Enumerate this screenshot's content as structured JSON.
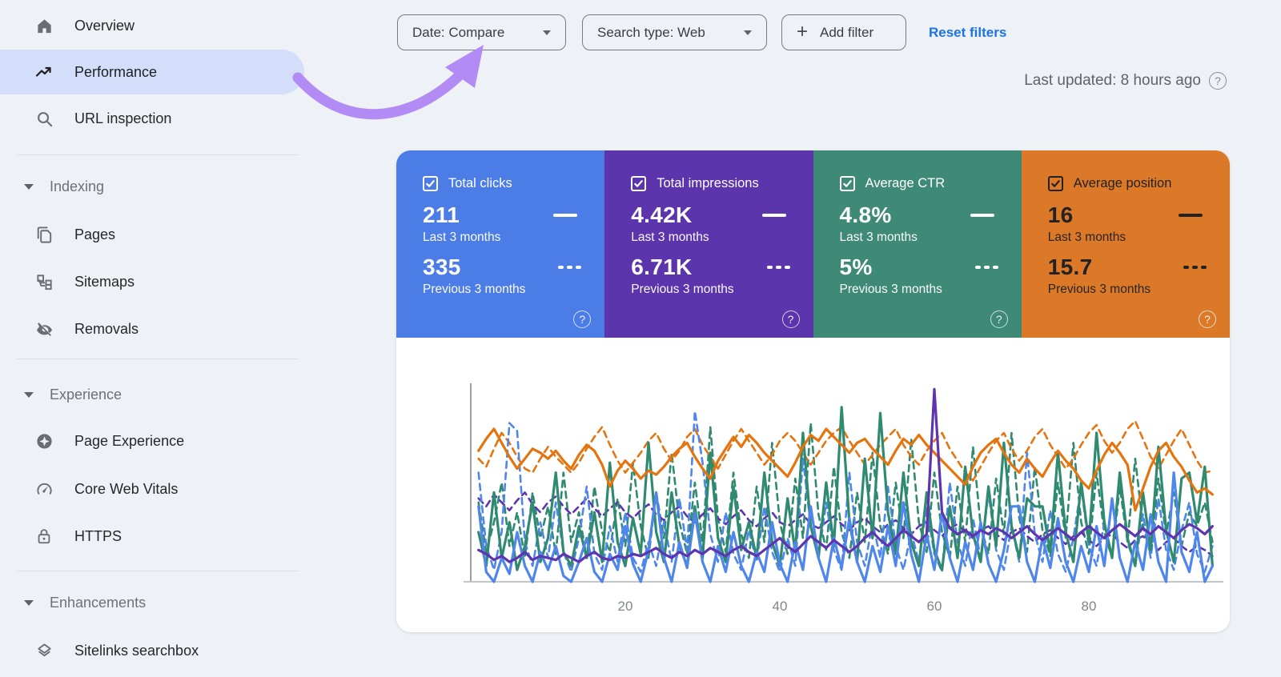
{
  "sidebar": {
    "items": [
      {
        "label": "Overview",
        "icon": "home-icon"
      },
      {
        "label": "Performance",
        "icon": "performance-icon",
        "active": true
      },
      {
        "label": "URL inspection",
        "icon": "search-icon"
      }
    ],
    "sections": [
      {
        "header": "Indexing",
        "items": [
          {
            "label": "Pages",
            "icon": "pages-icon"
          },
          {
            "label": "Sitemaps",
            "icon": "sitemaps-icon"
          },
          {
            "label": "Removals",
            "icon": "eye-off-icon"
          }
        ]
      },
      {
        "header": "Experience",
        "items": [
          {
            "label": "Page Experience",
            "icon": "page-experience-icon"
          },
          {
            "label": "Core Web Vitals",
            "icon": "speedometer-icon"
          },
          {
            "label": "HTTPS",
            "icon": "lock-icon"
          }
        ]
      },
      {
        "header": "Enhancements",
        "items": [
          {
            "label": "Sitelinks searchbox",
            "icon": "layers-icon"
          }
        ]
      }
    ],
    "active_pill_color": "#d3defb"
  },
  "toolbar": {
    "date_filter": "Date: Compare",
    "search_type_filter": "Search type: Web",
    "add_filter_label": "Add filter",
    "reset_filters_label": "Reset filters",
    "last_updated": "Last updated: 8 hours ago",
    "link_color": "#1a73e8"
  },
  "cards": [
    {
      "label": "Total clicks",
      "bg": "#4c7de6",
      "text": "#ffffff",
      "current": "211",
      "current_caption": "Last 3 months",
      "previous": "335",
      "previous_caption": "Previous 3 months",
      "checked": true
    },
    {
      "label": "Total impressions",
      "bg": "#5c34ac",
      "text": "#ffffff",
      "current": "4.42K",
      "current_caption": "Last 3 months",
      "previous": "6.71K",
      "previous_caption": "Previous 3 months",
      "checked": true
    },
    {
      "label": "Average CTR",
      "bg": "#3f8977",
      "text": "#ffffff",
      "current": "4.8%",
      "current_caption": "Last 3 months",
      "previous": "5%",
      "previous_caption": "Previous 3 months",
      "checked": true
    },
    {
      "label": "Average position",
      "bg": "#dc7928",
      "text": "#222222",
      "current": "16",
      "current_caption": "Last 3 months",
      "previous": "15.7",
      "previous_caption": "Previous 3 months",
      "checked": true
    }
  ],
  "chart_data": {
    "type": "line",
    "title": "",
    "xlabel": "",
    "ylabel": "",
    "x_ticks": [
      20,
      40,
      60,
      80
    ],
    "x_unit": "days",
    "x_range": [
      1,
      96
    ],
    "y_axis_unlabeled": true,
    "values_unit": "percent of plot height (0 = baseline, 100 = top; each metric has its own hidden scale)",
    "grid": false,
    "legend": "none (series colors match the metric cards; solid = Last 3 months, dashed = Previous 3 months)",
    "series": [
      {
        "name": "Average CTR — Previous 3 months",
        "metric": "ctr",
        "period": "previous",
        "color": "#2f8a70",
        "style": "dashed",
        "values": [
          40,
          15,
          30,
          50,
          18,
          35,
          12,
          45,
          22,
          38,
          14,
          55,
          20,
          35,
          12,
          48,
          25,
          15,
          42,
          18,
          60,
          28,
          12,
          45,
          22,
          65,
          30,
          14,
          50,
          20,
          78,
          32,
          15,
          55,
          24,
          12,
          48,
          20,
          70,
          30,
          14,
          52,
          22,
          80,
          34,
          16,
          58,
          25,
          12,
          45,
          20,
          65,
          28,
          14,
          50,
          22,
          72,
          30,
          15,
          55,
          25,
          12,
          48,
          20,
          68,
          28,
          14,
          52,
          24,
          75,
          32,
          15,
          58,
          26,
          13,
          50,
          22,
          70,
          30,
          14,
          55,
          25,
          12,
          48,
          20,
          62,
          28,
          14,
          52,
          24,
          45,
          18,
          35,
          28,
          40,
          20
        ]
      },
      {
        "name": "Average position — Previous 3 months",
        "metric": "position",
        "period": "previous",
        "color": "#e5740f",
        "style": "dashed",
        "values": [
          62,
          58,
          67,
          75,
          70,
          63,
          57,
          55,
          62,
          68,
          63,
          59,
          55,
          60,
          67,
          73,
          78,
          69,
          61,
          55,
          60,
          65,
          71,
          75,
          67,
          61,
          66,
          73,
          77,
          69,
          63,
          57,
          64,
          71,
          77,
          71,
          65,
          59,
          64,
          71,
          75,
          71,
          65,
          59,
          65,
          71,
          75,
          78,
          71,
          65,
          59,
          64,
          69,
          73,
          77,
          69,
          63,
          59,
          66,
          71,
          75,
          67,
          61,
          55,
          51,
          58,
          65,
          71,
          75,
          67,
          61,
          66,
          73,
          77,
          69,
          63,
          57,
          62,
          69,
          75,
          79,
          71,
          65,
          70,
          77,
          81,
          72,
          63,
          57,
          64,
          71,
          77,
          69,
          61,
          55,
          56
        ]
      },
      {
        "name": "Total impressions — Previous 3 months",
        "metric": "impressions",
        "period": "previous",
        "color": "#5e35b1",
        "style": "dashed",
        "values": [
          42,
          38,
          44,
          40,
          36,
          41,
          45,
          39,
          35,
          40,
          43,
          38,
          34,
          38,
          42,
          37,
          33,
          37,
          40,
          35,
          32,
          36,
          39,
          34,
          31,
          35,
          38,
          33,
          30,
          34,
          37,
          32,
          29,
          33,
          36,
          31,
          28,
          32,
          35,
          30,
          28,
          31,
          34,
          29,
          27,
          30,
          33,
          29,
          26,
          30,
          32,
          28,
          25,
          29,
          31,
          27,
          24,
          28,
          30,
          26,
          23,
          27,
          29,
          25,
          22,
          26,
          28,
          24,
          21,
          25,
          27,
          23,
          20,
          24,
          26,
          22,
          19,
          23,
          25,
          21,
          18,
          22,
          24,
          20,
          17,
          21,
          23,
          19,
          16,
          20,
          22,
          18,
          15,
          18,
          16,
          13
        ]
      },
      {
        "name": "Total clicks — Previous 3 months",
        "metric": "clicks",
        "period": "previous",
        "color": "#4f86ec",
        "style": "dashed",
        "values": [
          55,
          18,
          6,
          25,
          80,
          76,
          20,
          8,
          30,
          12,
          40,
          15,
          5,
          22,
          48,
          14,
          6,
          28,
          10,
          35,
          12,
          5,
          20,
          8,
          30,
          10,
          42,
          16,
          86,
          60,
          24,
          10,
          35,
          14,
          6,
          26,
          10,
          38,
          15,
          5,
          22,
          8,
          62,
          28,
          12,
          40,
          16,
          6,
          55,
          20,
          8,
          30,
          12,
          48,
          18,
          6,
          25,
          10,
          38,
          14,
          5,
          50,
          20,
          8,
          32,
          12,
          45,
          16,
          6,
          28,
          10,
          65,
          24,
          10,
          36,
          14,
          5,
          22,
          48,
          18,
          8,
          30,
          12,
          55,
          20,
          8,
          34,
          12,
          42,
          16,
          6,
          26,
          40,
          14,
          5,
          18
        ]
      },
      {
        "name": "Average CTR — Last 3 months",
        "metric": "ctr",
        "period": "current",
        "color": "#2f8a70",
        "style": "solid",
        "values": [
          25,
          8,
          45,
          12,
          30,
          6,
          18,
          40,
          10,
          22,
          55,
          15,
          8,
          28,
          12,
          35,
          10,
          60,
          20,
          8,
          32,
          14,
          70,
          25,
          10,
          45,
          18,
          8,
          38,
          12,
          65,
          22,
          10,
          48,
          16,
          30,
          12,
          55,
          20,
          8,
          42,
          15,
          75,
          28,
          12,
          50,
          18,
          88,
          30,
          10,
          62,
          22,
          85,
          35,
          14,
          55,
          20,
          8,
          45,
          16,
          6,
          38,
          12,
          58,
          24,
          10,
          48,
          18,
          70,
          28,
          12,
          42,
          38,
          38,
          15,
          65,
          25,
          10,
          50,
          20,
          75,
          30,
          12,
          55,
          22,
          8,
          45,
          16,
          68,
          26,
          10,
          52,
          55,
          30,
          58,
          8
        ]
      },
      {
        "name": "Average position — Last 3 months",
        "metric": "position",
        "period": "current",
        "color": "#e5740f",
        "style": "solid",
        "values": [
          66,
          72,
          77,
          70,
          63,
          57,
          62,
          67,
          65,
          62,
          66,
          61,
          57,
          64,
          69,
          66,
          59,
          48,
          56,
          61,
          57,
          52,
          56,
          54,
          58,
          63,
          67,
          70,
          63,
          57,
          52,
          61,
          67,
          73,
          68,
          74,
          70,
          65,
          61,
          57,
          53,
          60,
          68,
          74,
          71,
          77,
          73,
          69,
          65,
          70,
          72,
          67,
          63,
          59,
          66,
          72,
          69,
          74,
          69,
          65,
          61,
          57,
          53,
          49,
          58,
          65,
          69,
          72,
          65,
          59,
          55,
          62,
          57,
          53,
          60,
          66,
          61,
          57,
          51,
          47,
          56,
          64,
          70,
          65,
          59,
          36,
          47,
          58,
          66,
          70,
          63,
          58,
          51,
          45,
          47,
          44
        ]
      },
      {
        "name": "Total clicks — Last 3 months",
        "metric": "clicks",
        "period": "current",
        "color": "#4f86ec",
        "style": "solid",
        "values": [
          38,
          5,
          0,
          12,
          4,
          25,
          8,
          0,
          15,
          6,
          18,
          3,
          0,
          10,
          22,
          5,
          0,
          14,
          6,
          28,
          9,
          0,
          16,
          45,
          12,
          0,
          20,
          7,
          35,
          10,
          0,
          18,
          5,
          25,
          8,
          0,
          15,
          5,
          30,
          9,
          0,
          20,
          6,
          38,
          12,
          0,
          22,
          7,
          32,
          10,
          0,
          18,
          5,
          28,
          8,
          40,
          14,
          0,
          24,
          6,
          35,
          12,
          0,
          20,
          6,
          30,
          9,
          0,
          16,
          38,
          38,
          10,
          0,
          22,
          7,
          32,
          10,
          0,
          18,
          5,
          28,
          8,
          42,
          12,
          0,
          20,
          6,
          34,
          10,
          0,
          55,
          15,
          5,
          25,
          0,
          8
        ]
      },
      {
        "name": "Total impressions — Last 3 months",
        "metric": "impressions",
        "period": "current",
        "color": "#5e35b1",
        "style": "solid",
        "values": [
          16,
          14,
          11,
          13,
          10,
          12,
          15,
          11,
          13,
          12,
          11,
          14,
          12,
          10,
          13,
          15,
          12,
          11,
          13,
          12,
          14,
          13,
          15,
          17,
          14,
          12,
          15,
          13,
          16,
          14,
          17,
          15,
          13,
          16,
          18,
          15,
          13,
          16,
          19,
          22,
          18,
          15,
          19,
          23,
          20,
          17,
          21,
          18,
          15,
          18,
          22,
          25,
          21,
          18,
          22,
          26,
          23,
          20,
          24,
          97,
          35,
          27,
          24,
          26,
          23,
          26,
          24,
          27,
          25,
          22,
          25,
          28,
          24,
          21,
          24,
          27,
          24,
          21,
          25,
          28,
          25,
          22,
          26,
          29,
          26,
          23,
          27,
          24,
          28,
          25,
          22,
          26,
          29,
          27,
          24,
          28
        ]
      }
    ],
    "axis_color": "#9aa0a6",
    "tick_label_color": "#80868b"
  },
  "annotation": {
    "arrow_color": "#b28cf4",
    "meaning": "arrow pointing from Performance nav item to Date: Compare filter"
  }
}
